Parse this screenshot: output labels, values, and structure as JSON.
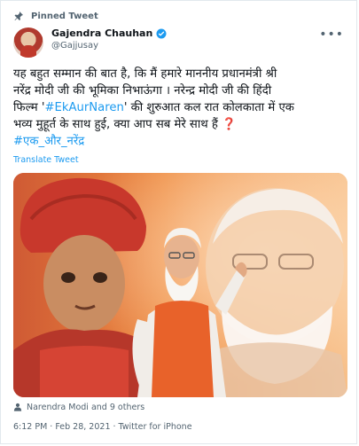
{
  "pinned_label": "Pinned Tweet",
  "author": {
    "name": "Gajendra Chauhan",
    "handle": "@Gajjusay"
  },
  "tweet": {
    "line1": "यह बहुत सम्मान की बात है, कि मैं हमारे माननीय प्रधानमंत्री श्री",
    "line2": "नरेंद्र मोदी जी की भूमिका निभाऊंगा । नरेन्द्र मोदी जी की हिंदी",
    "line3_prefix": "फिल्म '",
    "line3_hashtag": "#EkAurNaren",
    "line3_suffix": "' की शुरुआत कल रात कोलकाता में एक",
    "line4": "भव्य मुहूर्त के साथ हुई, क्या आप सब मेरे साथ हैं ",
    "question_mark": "❓",
    "hashtag2": "#एक_और_नरेंद्र",
    "translate": "Translate Tweet"
  },
  "tagged": "Narendra Modi and 9 others",
  "meta": "6:12 PM · Feb 28, 2021 · Twitter for iPhone",
  "colors": {
    "link": "#1d9bf0",
    "secondary_text": "#536471",
    "verified": "#1d9bf0",
    "question": "#e0245e"
  },
  "icons": {
    "pin": "pin-icon",
    "verified": "verified-badge-icon",
    "more": "more-options-icon",
    "tag": "person-tag-icon"
  }
}
